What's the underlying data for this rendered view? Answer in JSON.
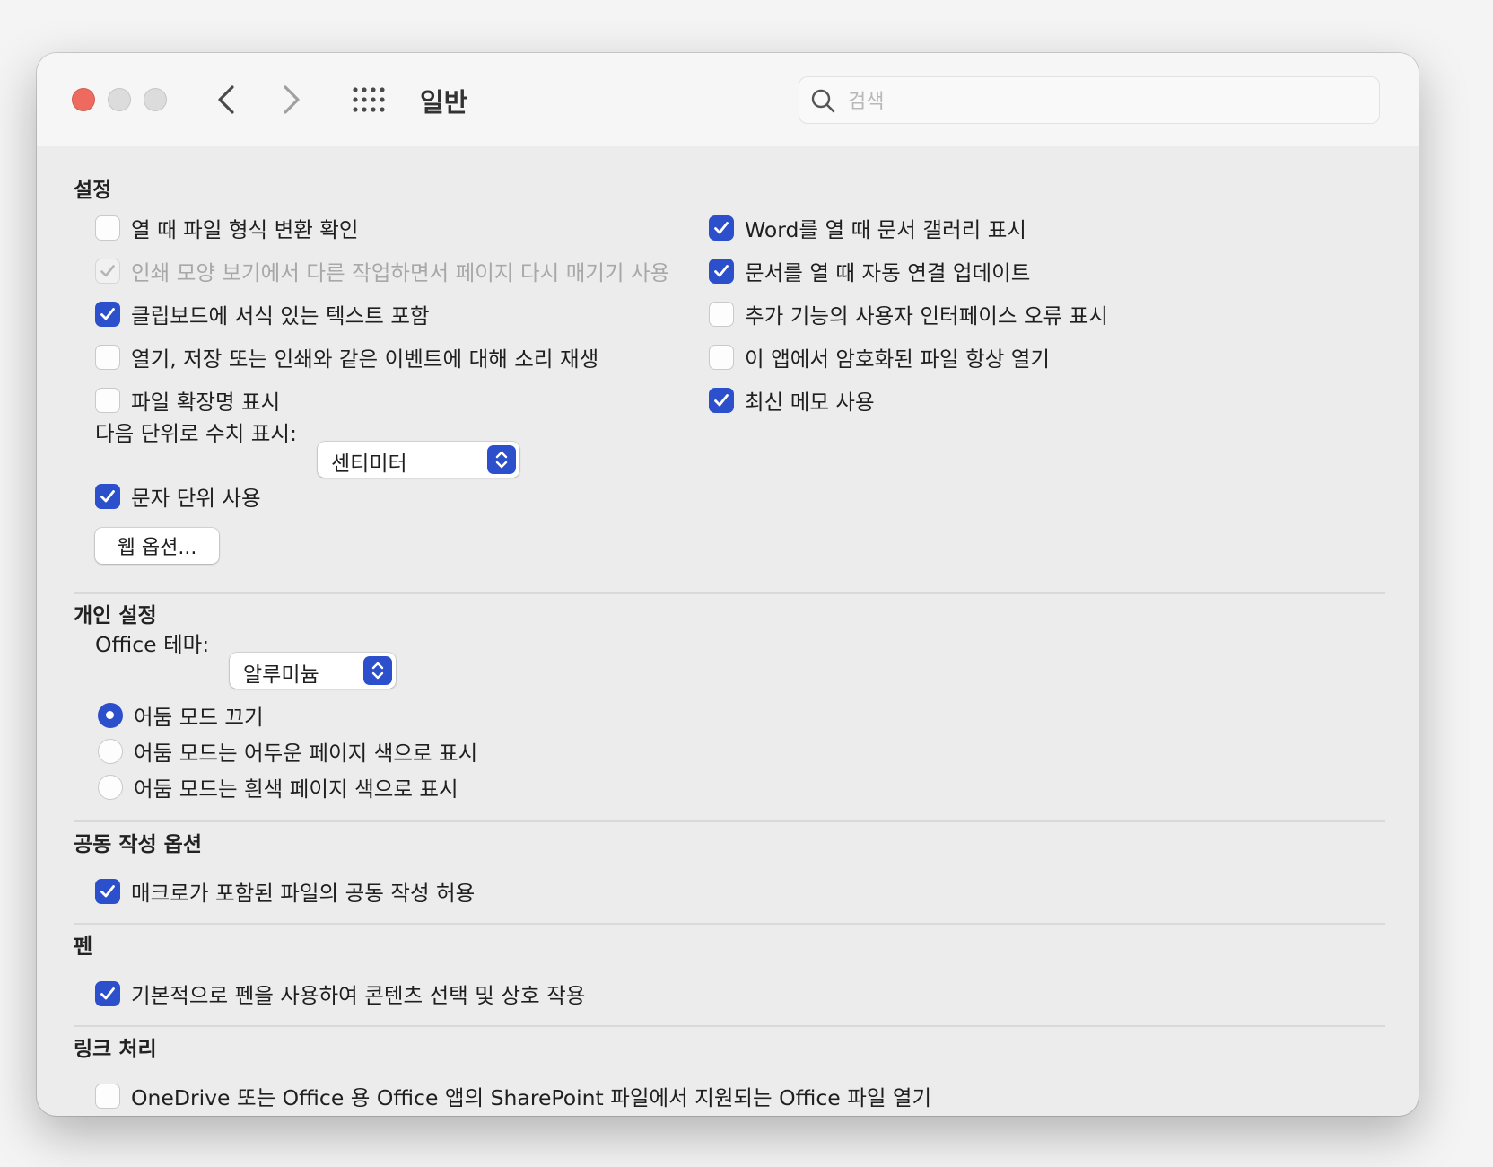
{
  "window": {
    "title": "일반"
  },
  "search": {
    "placeholder": "검색",
    "value": ""
  },
  "icons": {
    "close": "red-circle",
    "minimize": "gray-circle",
    "zoom": "gray-circle",
    "back": "chevron-left-icon",
    "forward": "chevron-right-icon",
    "grid": "grid-icon",
    "search": "magnifier-icon"
  },
  "colors": {
    "accent": "#2c4fcb",
    "close": "#ee6a5f"
  },
  "settings": {
    "title": "설정",
    "left": [
      {
        "label": "열 때 파일 형식 변환 확인",
        "checked": false
      },
      {
        "label": "인쇄 모양 보기에서 다른 작업하면서 페이지 다시 매기기 사용",
        "checked": true,
        "disabled": true
      },
      {
        "label": "클립보드에 서식 있는 텍스트 포함",
        "checked": true
      },
      {
        "label": "열기, 저장 또는 인쇄와 같은 이벤트에 대해 소리 재생",
        "checked": false
      },
      {
        "label": "파일 확장명 표시",
        "checked": false
      }
    ],
    "right": [
      {
        "label": "Word를 열 때 문서 갤러리 표시",
        "checked": true
      },
      {
        "label": "문서를 열 때 자동 연결 업데이트",
        "checked": true
      },
      {
        "label": "추가 기능의 사용자 인터페이스 오류 표시",
        "checked": false
      },
      {
        "label": "이 앱에서 암호화된 파일 항상 열기",
        "checked": false
      },
      {
        "label": "최신 메모 사용",
        "checked": true
      }
    ],
    "units_label": "다음 단위로 수치 표시:",
    "units_value": "센티미터",
    "char_units": {
      "label": "문자 단위 사용",
      "checked": true
    },
    "web_options_button": "웹 옵션..."
  },
  "personal": {
    "title": "개인 설정",
    "theme_label": "Office 테마:",
    "theme_value": "알루미늄",
    "radios": [
      {
        "label": "어둠 모드 끄기",
        "selected": true
      },
      {
        "label": "어둠 모드는 어두운 페이지 색으로 표시",
        "selected": false
      },
      {
        "label": "어둠 모드는 흰색 페이지 색으로 표시",
        "selected": false
      }
    ]
  },
  "coauth": {
    "title": "공동 작성 옵션",
    "item": {
      "label": "매크로가 포함된 파일의 공동 작성 허용",
      "checked": true
    }
  },
  "pen": {
    "title": "펜",
    "item": {
      "label": "기본적으로 펜을 사용하여 콘텐츠 선택 및 상호 작용",
      "checked": true
    }
  },
  "links": {
    "title": "링크 처리",
    "item": {
      "label": "OneDrive 또는 Office 용 Office 앱의 SharePoint 파일에서 지원되는 Office 파일 열기",
      "checked": false
    }
  }
}
